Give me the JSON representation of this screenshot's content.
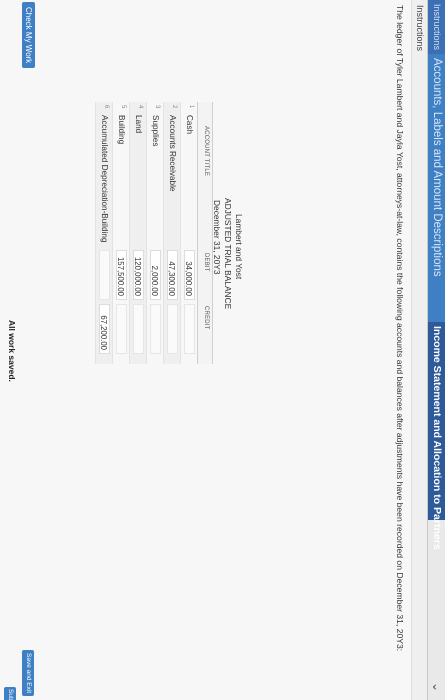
{
  "tabs": [
    {
      "label": "Instructions"
    },
    {
      "label": "Accounts, Labels and Amount Descriptions"
    },
    {
      "label": "Income Statement and Allocation to Partners"
    }
  ],
  "instructions": {
    "label": "Instructions",
    "text": "The ledger of Tyler Lambert and Jayla Yost, attorneys-at-law, contains the following accounts and balances after adjustments have been recorded on December 31, 20Y3:"
  },
  "header": {
    "company": "Lambert and Yost",
    "report": "ADJUSTED TRIAL BALANCE",
    "date": "December 31, 20Y3"
  },
  "table": {
    "col_title": "ACCOUNT TITLE",
    "col_debit": "DEBIT",
    "col_credit": "CREDIT",
    "rows": [
      {
        "num": "1",
        "account": "Cash",
        "debit": "34,000.00",
        "credit": ""
      },
      {
        "num": "2",
        "account": "Accounts Receivable",
        "debit": "47,300.00",
        "credit": ""
      },
      {
        "num": "3",
        "account": "Supplies",
        "debit": "2,000.00",
        "credit": ""
      },
      {
        "num": "4",
        "account": "Land",
        "debit": "120,000.00",
        "credit": ""
      },
      {
        "num": "5",
        "account": "Building",
        "debit": "157,500.00",
        "credit": ""
      },
      {
        "num": "6",
        "account": "Accumulated Depreciation-Building",
        "debit": "",
        "credit": "67,200.00"
      }
    ]
  },
  "footer": {
    "check_label": "Check My Work",
    "status": "All work saved.",
    "save_exit": "Save and Exit",
    "submit": "Sub"
  }
}
